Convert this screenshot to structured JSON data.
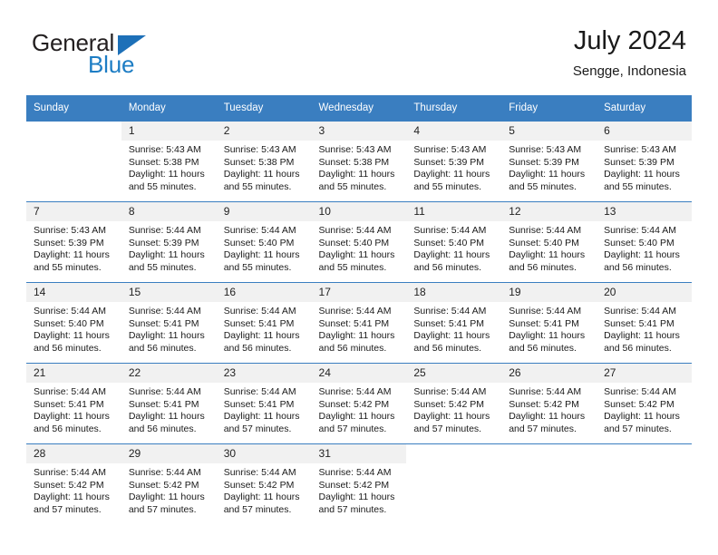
{
  "brand": {
    "name_dark": "General",
    "name_blue": "Blue",
    "logo_icon": "triangle-icon",
    "accent_color": "#1d70b8"
  },
  "header": {
    "title": "July 2024",
    "location": "Sengge, Indonesia"
  },
  "theme": {
    "header_blue": "#3a7ec0",
    "daynum_band": "#f1f1f1",
    "text": "#1a1a1a"
  },
  "weekday_headers": [
    "Sunday",
    "Monday",
    "Tuesday",
    "Wednesday",
    "Thursday",
    "Friday",
    "Saturday"
  ],
  "labels": {
    "sunrise_prefix": "Sunrise:",
    "sunset_prefix": "Sunset:",
    "daylight_prefix": "Daylight:"
  },
  "weeks": [
    [
      {
        "day": "",
        "sunrise": "",
        "sunset": "",
        "daylight_line1": "",
        "daylight_line2": "",
        "blank": true
      },
      {
        "day": "1",
        "sunrise": "Sunrise: 5:43 AM",
        "sunset": "Sunset: 5:38 PM",
        "daylight_line1": "Daylight: 11 hours",
        "daylight_line2": "and 55 minutes."
      },
      {
        "day": "2",
        "sunrise": "Sunrise: 5:43 AM",
        "sunset": "Sunset: 5:38 PM",
        "daylight_line1": "Daylight: 11 hours",
        "daylight_line2": "and 55 minutes."
      },
      {
        "day": "3",
        "sunrise": "Sunrise: 5:43 AM",
        "sunset": "Sunset: 5:38 PM",
        "daylight_line1": "Daylight: 11 hours",
        "daylight_line2": "and 55 minutes."
      },
      {
        "day": "4",
        "sunrise": "Sunrise: 5:43 AM",
        "sunset": "Sunset: 5:39 PM",
        "daylight_line1": "Daylight: 11 hours",
        "daylight_line2": "and 55 minutes."
      },
      {
        "day": "5",
        "sunrise": "Sunrise: 5:43 AM",
        "sunset": "Sunset: 5:39 PM",
        "daylight_line1": "Daylight: 11 hours",
        "daylight_line2": "and 55 minutes."
      },
      {
        "day": "6",
        "sunrise": "Sunrise: 5:43 AM",
        "sunset": "Sunset: 5:39 PM",
        "daylight_line1": "Daylight: 11 hours",
        "daylight_line2": "and 55 minutes."
      }
    ],
    [
      {
        "day": "7",
        "sunrise": "Sunrise: 5:43 AM",
        "sunset": "Sunset: 5:39 PM",
        "daylight_line1": "Daylight: 11 hours",
        "daylight_line2": "and 55 minutes."
      },
      {
        "day": "8",
        "sunrise": "Sunrise: 5:44 AM",
        "sunset": "Sunset: 5:39 PM",
        "daylight_line1": "Daylight: 11 hours",
        "daylight_line2": "and 55 minutes."
      },
      {
        "day": "9",
        "sunrise": "Sunrise: 5:44 AM",
        "sunset": "Sunset: 5:40 PM",
        "daylight_line1": "Daylight: 11 hours",
        "daylight_line2": "and 55 minutes."
      },
      {
        "day": "10",
        "sunrise": "Sunrise: 5:44 AM",
        "sunset": "Sunset: 5:40 PM",
        "daylight_line1": "Daylight: 11 hours",
        "daylight_line2": "and 55 minutes."
      },
      {
        "day": "11",
        "sunrise": "Sunrise: 5:44 AM",
        "sunset": "Sunset: 5:40 PM",
        "daylight_line1": "Daylight: 11 hours",
        "daylight_line2": "and 56 minutes."
      },
      {
        "day": "12",
        "sunrise": "Sunrise: 5:44 AM",
        "sunset": "Sunset: 5:40 PM",
        "daylight_line1": "Daylight: 11 hours",
        "daylight_line2": "and 56 minutes."
      },
      {
        "day": "13",
        "sunrise": "Sunrise: 5:44 AM",
        "sunset": "Sunset: 5:40 PM",
        "daylight_line1": "Daylight: 11 hours",
        "daylight_line2": "and 56 minutes."
      }
    ],
    [
      {
        "day": "14",
        "sunrise": "Sunrise: 5:44 AM",
        "sunset": "Sunset: 5:40 PM",
        "daylight_line1": "Daylight: 11 hours",
        "daylight_line2": "and 56 minutes."
      },
      {
        "day": "15",
        "sunrise": "Sunrise: 5:44 AM",
        "sunset": "Sunset: 5:41 PM",
        "daylight_line1": "Daylight: 11 hours",
        "daylight_line2": "and 56 minutes."
      },
      {
        "day": "16",
        "sunrise": "Sunrise: 5:44 AM",
        "sunset": "Sunset: 5:41 PM",
        "daylight_line1": "Daylight: 11 hours",
        "daylight_line2": "and 56 minutes."
      },
      {
        "day": "17",
        "sunrise": "Sunrise: 5:44 AM",
        "sunset": "Sunset: 5:41 PM",
        "daylight_line1": "Daylight: 11 hours",
        "daylight_line2": "and 56 minutes."
      },
      {
        "day": "18",
        "sunrise": "Sunrise: 5:44 AM",
        "sunset": "Sunset: 5:41 PM",
        "daylight_line1": "Daylight: 11 hours",
        "daylight_line2": "and 56 minutes."
      },
      {
        "day": "19",
        "sunrise": "Sunrise: 5:44 AM",
        "sunset": "Sunset: 5:41 PM",
        "daylight_line1": "Daylight: 11 hours",
        "daylight_line2": "and 56 minutes."
      },
      {
        "day": "20",
        "sunrise": "Sunrise: 5:44 AM",
        "sunset": "Sunset: 5:41 PM",
        "daylight_line1": "Daylight: 11 hours",
        "daylight_line2": "and 56 minutes."
      }
    ],
    [
      {
        "day": "21",
        "sunrise": "Sunrise: 5:44 AM",
        "sunset": "Sunset: 5:41 PM",
        "daylight_line1": "Daylight: 11 hours",
        "daylight_line2": "and 56 minutes."
      },
      {
        "day": "22",
        "sunrise": "Sunrise: 5:44 AM",
        "sunset": "Sunset: 5:41 PM",
        "daylight_line1": "Daylight: 11 hours",
        "daylight_line2": "and 56 minutes."
      },
      {
        "day": "23",
        "sunrise": "Sunrise: 5:44 AM",
        "sunset": "Sunset: 5:41 PM",
        "daylight_line1": "Daylight: 11 hours",
        "daylight_line2": "and 57 minutes."
      },
      {
        "day": "24",
        "sunrise": "Sunrise: 5:44 AM",
        "sunset": "Sunset: 5:42 PM",
        "daylight_line1": "Daylight: 11 hours",
        "daylight_line2": "and 57 minutes."
      },
      {
        "day": "25",
        "sunrise": "Sunrise: 5:44 AM",
        "sunset": "Sunset: 5:42 PM",
        "daylight_line1": "Daylight: 11 hours",
        "daylight_line2": "and 57 minutes."
      },
      {
        "day": "26",
        "sunrise": "Sunrise: 5:44 AM",
        "sunset": "Sunset: 5:42 PM",
        "daylight_line1": "Daylight: 11 hours",
        "daylight_line2": "and 57 minutes."
      },
      {
        "day": "27",
        "sunrise": "Sunrise: 5:44 AM",
        "sunset": "Sunset: 5:42 PM",
        "daylight_line1": "Daylight: 11 hours",
        "daylight_line2": "and 57 minutes."
      }
    ],
    [
      {
        "day": "28",
        "sunrise": "Sunrise: 5:44 AM",
        "sunset": "Sunset: 5:42 PM",
        "daylight_line1": "Daylight: 11 hours",
        "daylight_line2": "and 57 minutes."
      },
      {
        "day": "29",
        "sunrise": "Sunrise: 5:44 AM",
        "sunset": "Sunset: 5:42 PM",
        "daylight_line1": "Daylight: 11 hours",
        "daylight_line2": "and 57 minutes."
      },
      {
        "day": "30",
        "sunrise": "Sunrise: 5:44 AM",
        "sunset": "Sunset: 5:42 PM",
        "daylight_line1": "Daylight: 11 hours",
        "daylight_line2": "and 57 minutes."
      },
      {
        "day": "31",
        "sunrise": "Sunrise: 5:44 AM",
        "sunset": "Sunset: 5:42 PM",
        "daylight_line1": "Daylight: 11 hours",
        "daylight_line2": "and 57 minutes."
      },
      {
        "day": "",
        "sunrise": "",
        "sunset": "",
        "daylight_line1": "",
        "daylight_line2": "",
        "blank": true
      },
      {
        "day": "",
        "sunrise": "",
        "sunset": "",
        "daylight_line1": "",
        "daylight_line2": "",
        "blank": true
      },
      {
        "day": "",
        "sunrise": "",
        "sunset": "",
        "daylight_line1": "",
        "daylight_line2": "",
        "blank": true
      }
    ]
  ]
}
